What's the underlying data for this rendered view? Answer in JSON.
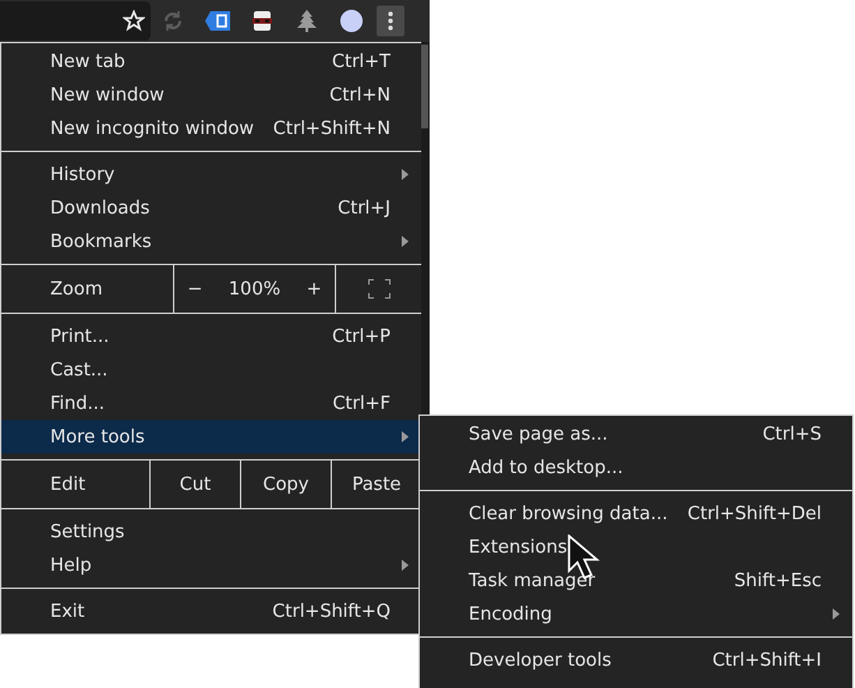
{
  "menu": {
    "sections": [
      {
        "kind": "items",
        "items": [
          {
            "label": "New tab",
            "shortcut": "Ctrl+T",
            "submenu": false,
            "selected": false
          },
          {
            "label": "New window",
            "shortcut": "Ctrl+N",
            "submenu": false,
            "selected": false
          },
          {
            "label": "New incognito window",
            "shortcut": "Ctrl+Shift+N",
            "submenu": false,
            "selected": false
          }
        ]
      },
      {
        "kind": "items",
        "items": [
          {
            "label": "History",
            "submenu": true,
            "selected": false
          },
          {
            "label": "Downloads",
            "shortcut": "Ctrl+J",
            "submenu": false,
            "selected": false
          },
          {
            "label": "Bookmarks",
            "submenu": true,
            "selected": false
          }
        ]
      },
      {
        "kind": "zoom",
        "label": "Zoom",
        "minus": "−",
        "level_text": "100%",
        "plus": "+"
      },
      {
        "kind": "items",
        "items": [
          {
            "label": "Print...",
            "shortcut": "Ctrl+P",
            "submenu": false,
            "selected": false
          },
          {
            "label": "Cast...",
            "submenu": false,
            "selected": false
          },
          {
            "label": "Find...",
            "shortcut": "Ctrl+F",
            "submenu": false,
            "selected": false
          },
          {
            "label": "More tools",
            "submenu": true,
            "selected": true
          }
        ]
      },
      {
        "kind": "edit",
        "label": "Edit",
        "buttons": [
          "Cut",
          "Copy",
          "Paste"
        ]
      },
      {
        "kind": "items",
        "items": [
          {
            "label": "Settings",
            "submenu": false,
            "selected": false
          },
          {
            "label": "Help",
            "submenu": true,
            "selected": false
          }
        ]
      },
      {
        "kind": "items",
        "items": [
          {
            "label": "Exit",
            "shortcut": "Ctrl+Shift+Q",
            "submenu": false,
            "selected": false
          }
        ]
      }
    ]
  },
  "submenu": {
    "sections": [
      {
        "kind": "items",
        "items": [
          {
            "label": "Save page as...",
            "shortcut": "Ctrl+S",
            "submenu": false,
            "selected": false
          },
          {
            "label": "Add to desktop...",
            "submenu": false,
            "selected": false
          }
        ]
      },
      {
        "kind": "items",
        "items": [
          {
            "label": "Clear browsing data...",
            "shortcut": "Ctrl+Shift+Del",
            "submenu": false,
            "selected": false
          },
          {
            "label": "Extensions",
            "submenu": false,
            "selected": false
          },
          {
            "label": "Task manager",
            "shortcut": "Shift+Esc",
            "submenu": false,
            "selected": false
          },
          {
            "label": "Encoding",
            "submenu": true,
            "selected": false
          }
        ]
      },
      {
        "kind": "items",
        "items": [
          {
            "label": "Developer tools",
            "shortcut": "Ctrl+Shift+I",
            "submenu": false,
            "selected": false
          }
        ]
      }
    ]
  }
}
